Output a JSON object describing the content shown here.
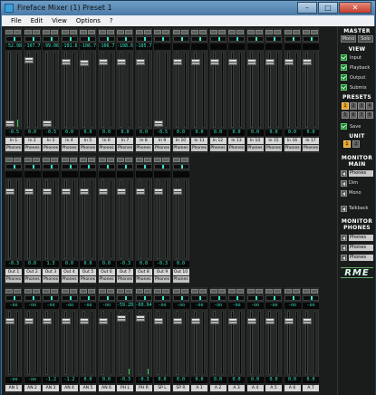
{
  "window": {
    "title": "Fireface Mixer (1) Preset 1"
  },
  "menu": [
    "File",
    "Edit",
    "View",
    "Options",
    "?"
  ],
  "inputs": {
    "peaks": [
      "-52.98",
      "-107.7",
      "-99.06",
      "-101.6",
      "-106.7",
      "-106.7",
      "-108.6",
      "-105.7",
      "",
      "",
      "",
      "",
      "",
      "",
      "",
      "",
      ""
    ],
    "gains": [
      "-0.5",
      "0.0",
      "-0.5",
      "0.0",
      "0.0",
      "0.0",
      "0.0",
      "0.0",
      "-0.5",
      "0.0",
      "0.0",
      "0.0",
      "0.0",
      "0.0",
      "0.0",
      "0.0",
      "0.0"
    ],
    "names": [
      "In 1",
      "In 2",
      "In 3",
      "In 4",
      "In 5",
      "In 6",
      "In 7",
      "In 8",
      "In 9",
      "In 10",
      "In 11",
      "In 12",
      "In 13",
      "In 14",
      "In 15",
      "In 16",
      "In 17"
    ],
    "routes": [
      "Phones",
      "Phones",
      "Phones",
      "Phones",
      "Phones",
      "Phones",
      "Phones",
      "Phones",
      "Phones",
      "Phones",
      "Phones",
      "Phones",
      "Phones",
      "Phones",
      "Phones",
      "Phones",
      "Phones"
    ],
    "fader_levels": [
      0.0,
      0.92,
      0.0,
      0.9,
      0.88,
      0.9,
      0.9,
      0.9,
      0.0,
      0.9,
      0.9,
      0.9,
      0.9,
      0.9,
      0.9,
      0.9,
      0.9
    ]
  },
  "playback": {
    "peaks": [
      "",
      "",
      "",
      "",
      "",
      "",
      "",
      ""
    ],
    "gains": [
      "-0.3",
      "0.0",
      "1.3",
      "0.0",
      "0.0",
      "0.0",
      "-0.3",
      "0.0"
    ],
    "names": [
      "Out 1",
      "Out 2",
      "Out 3",
      "Out 4",
      "Out 5",
      "Out 6",
      "Out 7",
      "Out 8",
      "Out 9",
      "Out 10"
    ],
    "routes": [
      "Phones",
      "Phones",
      "Phones",
      "Phones",
      "Phones",
      "Phones",
      "Phones",
      "Phones",
      "Phones",
      "Phones"
    ]
  },
  "outputs": {
    "peaks": [
      "-oo",
      "-oo",
      "-oo",
      "-oo",
      "-oo",
      "-oo",
      "-59.28",
      "-60.94",
      "-oo",
      "-oo",
      "-oo",
      "-oo",
      "-oo",
      "-oo",
      "-oo",
      "-oo",
      "-oo"
    ],
    "gains": [
      "-oo",
      "-oo",
      "-1.2",
      "-1.2",
      "0.0",
      "0.0",
      "-0.3",
      "-0.3",
      "0.0",
      "0.0",
      "0.0",
      "0.0",
      "0.0",
      "0.0",
      "0.0",
      "0.0",
      "0.0"
    ],
    "names": [
      "AN 1",
      "AN 2",
      "AN 3",
      "AN 4",
      "AN 5",
      "AN 6",
      "PH L",
      "PH R",
      "SP L",
      "SP R",
      "A 1",
      "A 2",
      "A 3",
      "A 4",
      "A 5",
      "A 6",
      "A 7",
      "A 8"
    ]
  },
  "panel": {
    "master": "MASTER",
    "master_btns": [
      "Mono",
      "Solo"
    ],
    "view": "VIEW",
    "view_items": [
      "Input",
      "Playback",
      "Output",
      "Submix"
    ],
    "presets": "PRESETS",
    "preset_nums": [
      "1",
      "2",
      "3",
      "4",
      "5",
      "6",
      "7",
      "8"
    ],
    "save": "Save",
    "unit": "UNIT",
    "unit_nums": [
      "1",
      "2"
    ],
    "monitor_main": "MONITOR MAIN",
    "monitor_items": [
      "Phones",
      "Dim",
      "Mono"
    ],
    "talkback": "Talkback",
    "monitor_phones": "MONITOR PHONES",
    "phones_items": [
      "Phones",
      "Phones",
      "Phones"
    ],
    "logo": "RME"
  },
  "colors": {
    "accent": "#37e6c8",
    "meter": "#28c94a",
    "preset_on": "#e0a020"
  }
}
